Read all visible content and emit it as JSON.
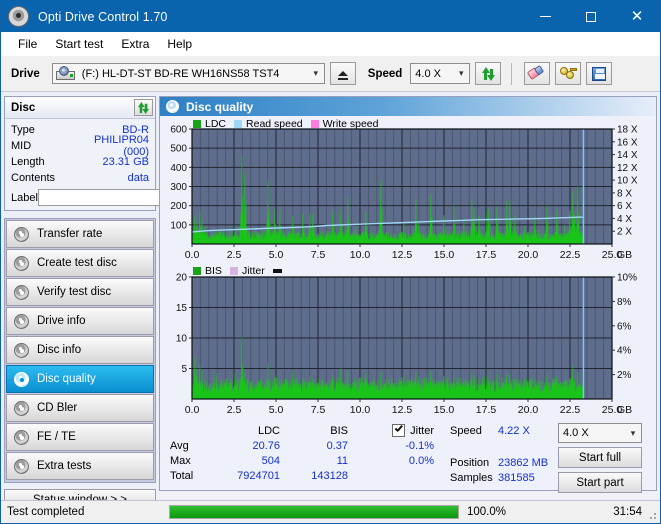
{
  "window": {
    "title": "Opti Drive Control 1.70",
    "icon": "disc-icon",
    "minimize": "–",
    "maximize": "□",
    "close": "✕"
  },
  "menu": {
    "items": [
      {
        "label": "File"
      },
      {
        "label": "Start test"
      },
      {
        "label": "Extra"
      },
      {
        "label": "Help"
      }
    ]
  },
  "toolbar": {
    "drive_label": "Drive",
    "drive_value": "(F:)   HL-DT-ST BD-RE  WH16NS58 TST4",
    "eject_icon": "eject-icon",
    "speed_label": "Speed",
    "speed_value": "4.0 X",
    "refresh_icon": "refresh-icon",
    "erase_icon": "eraser-icon",
    "keys_icon": "keys-icon",
    "save_icon": "save-icon"
  },
  "disc_panel": {
    "title": "Disc",
    "refresh_icon": "refresh-icon",
    "rows": [
      {
        "key": "Type",
        "value": "BD-R"
      },
      {
        "key": "MID",
        "value": "PHILIPR04 (000)"
      },
      {
        "key": "Length",
        "value": "23.31 GB"
      },
      {
        "key": "Contents",
        "value": "data"
      }
    ],
    "label_key": "Label",
    "label_value": "",
    "label_placeholder": "",
    "cd_icon": "cd-icon"
  },
  "nav": {
    "items": [
      {
        "label": "Transfer rate",
        "icon": "transfer-rate-icon",
        "active": false
      },
      {
        "label": "Create test disc",
        "icon": "create-test-disc-icon",
        "active": false
      },
      {
        "label": "Verify test disc",
        "icon": "verify-test-disc-icon",
        "active": false
      },
      {
        "label": "Drive info",
        "icon": "drive-info-icon",
        "active": false
      },
      {
        "label": "Disc info",
        "icon": "disc-info-icon",
        "active": false
      },
      {
        "label": "Disc quality",
        "icon": "disc-quality-icon",
        "active": true
      },
      {
        "label": "CD Bler",
        "icon": "cd-bler-icon",
        "active": false
      },
      {
        "label": "FE / TE",
        "icon": "fe-te-icon",
        "active": false
      },
      {
        "label": "Extra tests",
        "icon": "extra-tests-icon",
        "active": false
      }
    ],
    "status_button": "Status window > >"
  },
  "content": {
    "header_title": "Disc quality",
    "header_icon": "disc-quality-icon"
  },
  "stats": {
    "col_ldc": "LDC",
    "col_bis": "BIS",
    "col_jitter": "Jitter",
    "jitter_checked": true,
    "rows": [
      {
        "key": "Avg",
        "ldc": "20.76",
        "bis": "0.37",
        "jitter": "-0.1%"
      },
      {
        "key": "Max",
        "ldc": "504",
        "bis": "11",
        "jitter": "0.0%"
      },
      {
        "key": "Total",
        "ldc": "7924701",
        "bis": "143128",
        "jitter": ""
      }
    ],
    "speed_key": "Speed",
    "speed_value": "4.22 X",
    "position_key": "Position",
    "position_value": "23862 MB",
    "samples_key": "Samples",
    "samples_value": "381585",
    "speed_select": "4.0 X",
    "start_full": "Start full",
    "start_part": "Start part"
  },
  "statusbar": {
    "text": "Test completed",
    "percent": "100.0%",
    "progress": 100,
    "time": "31:54"
  },
  "colors": {
    "accent": "#0a63ad",
    "plot_bg": "#5f6d8c",
    "ldc_green": "#19c519",
    "read_speed": "#9fd9f6",
    "write_speed": "#ff7de0",
    "value_blue": "#1431d2",
    "progress_green": "#0d980d"
  },
  "chart_data": [
    {
      "type": "area",
      "name": "ldc-chart",
      "title": "",
      "xlabel": "GB",
      "ylabel": "",
      "xlim": [
        0,
        25
      ],
      "ylim": [
        0,
        600
      ],
      "y2lim": [
        0,
        18
      ],
      "y2label": "X",
      "grid": true,
      "legend_position": "top-left",
      "legend": [
        {
          "label": "LDC",
          "color": "#19a319"
        },
        {
          "label": "Read speed",
          "color": "#9fd9f6"
        },
        {
          "label": "Write speed",
          "color": "#ff7de0"
        }
      ],
      "xticks": [
        "0.0",
        "2.5",
        "5.0",
        "7.5",
        "10.0",
        "12.5",
        "15.0",
        "17.5",
        "20.0",
        "22.5",
        "25.0"
      ],
      "yticks": [
        100,
        200,
        300,
        400,
        500,
        600
      ],
      "y2ticks": [
        "2 X",
        "4 X",
        "6 X",
        "8 X",
        "10 X",
        "12 X",
        "14 X",
        "16 X",
        "18 X"
      ],
      "data_end_x": 23.3,
      "series": [
        {
          "name": "LDC",
          "color": "#19c519",
          "x": [
            0.0,
            0.15,
            0.3,
            0.45,
            0.6,
            0.75,
            0.9,
            1.05,
            1.2,
            1.35,
            1.5,
            1.65,
            1.8,
            1.95,
            2.1,
            2.25,
            2.4,
            2.55,
            2.7,
            2.85,
            3.0,
            3.15,
            3.3,
            3.45,
            3.6,
            3.75,
            3.9,
            4.05,
            4.2,
            4.35,
            4.5,
            4.65,
            4.8,
            4.95,
            5.1,
            5.25,
            5.4,
            5.55,
            5.7,
            5.85,
            6.0,
            6.15,
            6.3,
            6.45,
            6.6,
            6.75,
            6.9,
            7.05,
            7.2,
            7.35,
            7.5,
            7.65,
            7.8,
            7.95,
            8.1,
            8.25,
            8.4,
            8.55,
            8.7,
            8.85,
            9.0,
            9.15,
            9.3,
            9.45,
            9.6,
            9.75,
            9.9,
            10.05,
            10.2,
            10.35,
            10.5,
            10.65,
            10.8,
            10.95,
            11.1,
            11.25,
            11.4,
            11.55,
            11.7,
            11.85,
            12.0,
            12.15,
            12.3,
            12.45,
            12.6,
            12.75,
            12.9,
            13.05,
            13.2,
            13.35,
            13.5,
            13.65,
            13.8,
            13.95,
            14.1,
            14.25,
            14.4,
            14.55,
            14.7,
            14.85,
            15.0,
            15.15,
            15.3,
            15.45,
            15.6,
            15.75,
            15.9,
            16.05,
            16.2,
            16.35,
            16.5,
            16.65,
            16.8,
            16.95,
            17.1,
            17.25,
            17.4,
            17.55,
            17.7,
            17.85,
            18.0,
            18.15,
            18.3,
            18.45,
            18.6,
            18.75,
            18.9,
            19.05,
            19.2,
            19.35,
            19.5,
            19.65,
            19.8,
            19.95,
            20.1,
            20.25,
            20.4,
            20.55,
            20.7,
            20.85,
            21.0,
            21.15,
            21.3,
            21.45,
            21.6,
            21.75,
            21.9,
            22.05,
            22.2,
            22.35,
            22.5,
            22.65,
            22.8,
            22.95,
            23.1,
            23.3
          ],
          "y": [
            95,
            150,
            120,
            175,
            130,
            95,
            70,
            60,
            55,
            50,
            60,
            55,
            48,
            52,
            60,
            50,
            55,
            90,
            60,
            55,
            458,
            370,
            90,
            70,
            60,
            55,
            60,
            70,
            58,
            52,
            330,
            110,
            62,
            185,
            70,
            175,
            60,
            58,
            64,
            55,
            150,
            60,
            58,
            56,
            160,
            62,
            58,
            160,
            160,
            58,
            60,
            55,
            60,
            58,
            52,
            58,
            180,
            60,
            58,
            180,
            60,
            62,
            240,
            58,
            60,
            90,
            58,
            55,
            60,
            170,
            58,
            62,
            56,
            60,
            62,
            335,
            60,
            58,
            62,
            60,
            60,
            56,
            58,
            60,
            110,
            58,
            60,
            58,
            62,
            230,
            120,
            60,
            60,
            58,
            58,
            260,
            62,
            58,
            60,
            58,
            150,
            62,
            58,
            56,
            200,
            58,
            60,
            58,
            120,
            60,
            62,
            225,
            190,
            58,
            150,
            62,
            58,
            170,
            190,
            60,
            58,
            195,
            60,
            62,
            62,
            225,
            230,
            62,
            150,
            62,
            60,
            60,
            95,
            58,
            62,
            58,
            145,
            58,
            60,
            62,
            62,
            200,
            60,
            58,
            60,
            180,
            62,
            60,
            100,
            60,
            175,
            280,
            150,
            300,
            60,
            58
          ]
        },
        {
          "name": "Read speed",
          "color": "#9fd9f6",
          "x": [
            0.0,
            1.0,
            2.0,
            3.0,
            4.0,
            5.0,
            6.0,
            7.0,
            8.0,
            9.0,
            10.0,
            11.0,
            12.0,
            13.0,
            14.0,
            15.0,
            16.0,
            17.0,
            18.0,
            19.0,
            20.0,
            21.0,
            22.0,
            23.0,
            23.3
          ],
          "y": [
            1.9,
            2.1,
            2.2,
            2.3,
            2.4,
            2.5,
            2.6,
            2.7,
            2.9,
            3.0,
            3.1,
            3.2,
            3.3,
            3.4,
            3.5,
            3.6,
            3.7,
            3.8,
            3.85,
            3.9,
            3.95,
            4.0,
            4.1,
            4.2,
            4.2
          ]
        }
      ],
      "cursor_x": 23.3
    },
    {
      "type": "area",
      "name": "bis-chart",
      "title": "",
      "xlabel": "GB",
      "ylabel": "",
      "xlim": [
        0,
        25
      ],
      "ylim": [
        0,
        20
      ],
      "y2lim": [
        0,
        10
      ],
      "y2label": "%",
      "grid": true,
      "legend_position": "top-left",
      "legend": [
        {
          "label": "BIS",
          "color": "#19a319"
        },
        {
          "label": "Jitter",
          "color": "#d8b2e0"
        }
      ],
      "xticks": [
        "0.0",
        "2.5",
        "5.0",
        "7.5",
        "10.0",
        "12.5",
        "15.0",
        "17.5",
        "20.0",
        "22.5",
        "25.0"
      ],
      "yticks": [
        5,
        10,
        15,
        20
      ],
      "y2ticks": [
        "2%",
        "4%",
        "6%",
        "8%",
        "10%"
      ],
      "data_end_x": 23.3,
      "series": [
        {
          "name": "BIS",
          "color": "#19c519",
          "x": [
            0.0,
            0.15,
            0.3,
            0.45,
            0.6,
            0.75,
            0.9,
            1.05,
            1.2,
            1.35,
            1.5,
            1.65,
            1.8,
            1.95,
            2.1,
            2.25,
            2.4,
            2.55,
            2.7,
            2.85,
            3.0,
            3.15,
            3.3,
            3.45,
            3.6,
            3.75,
            3.9,
            4.05,
            4.2,
            4.35,
            4.5,
            4.65,
            4.8,
            4.95,
            5.1,
            5.25,
            5.4,
            5.55,
            5.7,
            5.85,
            6.0,
            6.15,
            6.3,
            6.45,
            6.6,
            6.75,
            6.9,
            7.05,
            7.2,
            7.35,
            7.5,
            7.65,
            7.8,
            7.95,
            8.1,
            8.25,
            8.4,
            8.55,
            8.7,
            8.85,
            9.0,
            9.15,
            9.3,
            9.45,
            9.6,
            9.75,
            9.9,
            10.05,
            10.2,
            10.35,
            10.5,
            10.65,
            10.8,
            10.95,
            11.1,
            11.25,
            11.4,
            11.55,
            11.7,
            11.85,
            12.0,
            12.15,
            12.3,
            12.45,
            12.6,
            12.75,
            12.9,
            13.05,
            13.2,
            13.35,
            13.5,
            13.65,
            13.8,
            13.95,
            14.1,
            14.25,
            14.4,
            14.55,
            14.7,
            14.85,
            15.0,
            15.15,
            15.3,
            15.45,
            15.6,
            15.75,
            15.9,
            16.05,
            16.2,
            16.35,
            16.5,
            16.65,
            16.8,
            16.95,
            17.1,
            17.25,
            17.4,
            17.55,
            17.7,
            17.85,
            18.0,
            18.15,
            18.3,
            18.45,
            18.6,
            18.75,
            18.9,
            19.05,
            19.2,
            19.35,
            19.5,
            19.65,
            19.8,
            19.95,
            20.1,
            20.25,
            20.4,
            20.55,
            20.7,
            20.85,
            21.0,
            21.15,
            21.3,
            21.45,
            21.6,
            21.75,
            21.9,
            22.05,
            22.2,
            22.35,
            22.5,
            22.65,
            22.8,
            22.95,
            23.1,
            23.3
          ],
          "y": [
            4.2,
            6.9,
            5.0,
            5.4,
            4.6,
            3.6,
            3.0,
            2.6,
            2.8,
            3.0,
            4.2,
            2.6,
            2.8,
            3.0,
            3.6,
            2.8,
            3.0,
            4.4,
            3.0,
            2.8,
            10.1,
            4.4,
            3.2,
            2.8,
            3.0,
            2.6,
            3.0,
            3.4,
            2.8,
            2.6,
            6.0,
            3.2,
            2.8,
            4.0,
            3.0,
            3.6,
            2.8,
            2.6,
            3.0,
            2.8,
            4.6,
            2.8,
            2.6,
            2.8,
            3.6,
            3.0,
            2.8,
            3.8,
            3.6,
            2.8,
            3.0,
            2.6,
            3.0,
            2.8,
            2.6,
            2.8,
            4.0,
            3.0,
            2.8,
            5.2,
            3.0,
            2.8,
            4.6,
            2.8,
            3.0,
            3.4,
            2.8,
            2.6,
            3.0,
            4.2,
            2.8,
            3.0,
            2.6,
            3.0,
            2.8,
            4.4,
            3.0,
            2.8,
            3.0,
            2.8,
            3.0,
            2.6,
            2.8,
            3.0,
            3.6,
            2.8,
            3.0,
            2.8,
            3.0,
            4.4,
            3.2,
            2.8,
            3.0,
            2.8,
            2.8,
            4.6,
            3.0,
            2.8,
            3.0,
            2.8,
            3.8,
            3.0,
            2.8,
            2.6,
            4.0,
            2.8,
            3.0,
            2.8,
            3.6,
            3.0,
            3.0,
            4.2,
            3.8,
            2.8,
            3.6,
            3.0,
            2.8,
            4.0,
            3.6,
            3.0,
            2.8,
            4.2,
            3.0,
            3.0,
            3.0,
            4.2,
            4.0,
            3.0,
            3.6,
            3.0,
            3.0,
            3.0,
            3.4,
            2.8,
            3.0,
            2.8,
            3.5,
            2.8,
            3.0,
            3.0,
            3.0,
            4.0,
            3.0,
            2.8,
            3.0,
            3.8,
            3.0,
            3.0,
            3.4,
            3.0,
            3.6,
            5.5,
            3.5,
            4.3,
            3.0,
            2.8
          ]
        }
      ],
      "cursor_x": 23.3
    }
  ]
}
